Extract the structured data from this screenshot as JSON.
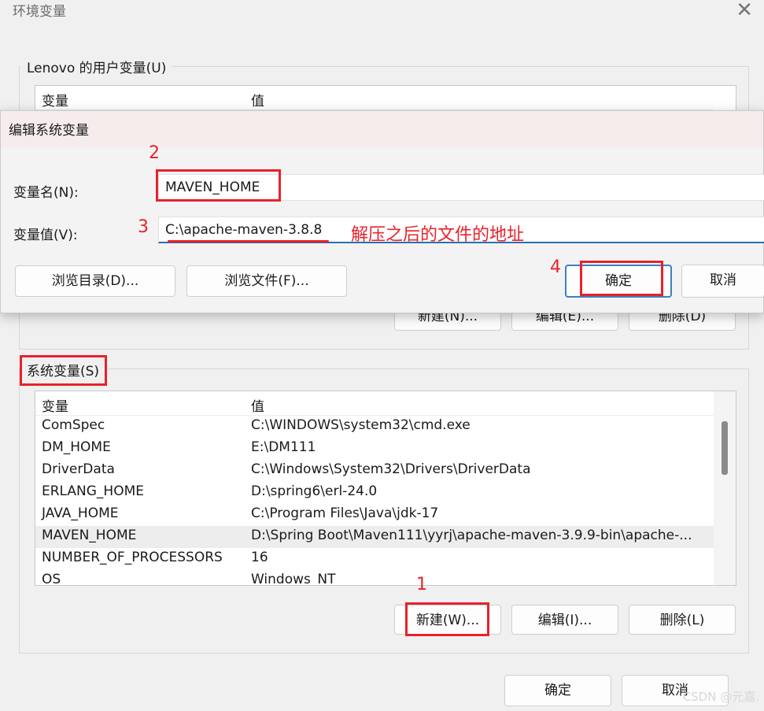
{
  "window": {
    "title": "环境变量",
    "close_glyph": "✕",
    "user_vars_label": "Lenovo 的用户变量(U)",
    "user_columns": [
      "变量",
      "值"
    ],
    "user_buttons": {
      "new": "新建(N)...",
      "edit": "编辑(E)...",
      "delete": "删除(D)"
    },
    "system_vars_label": "系统变量(S)",
    "system_columns": [
      "变量",
      "值"
    ],
    "system_rows": [
      {
        "name": "ComSpec",
        "value": "C:\\WINDOWS\\system32\\cmd.exe"
      },
      {
        "name": "DM_HOME",
        "value": "E:\\DM111"
      },
      {
        "name": "DriverData",
        "value": "C:\\Windows\\System32\\Drivers\\DriverData"
      },
      {
        "name": "ERLANG_HOME",
        "value": "D:\\spring6\\erl-24.0"
      },
      {
        "name": "JAVA_HOME",
        "value": "C:\\Program Files\\Java\\jdk-17"
      },
      {
        "name": "MAVEN_HOME",
        "value": "D:\\Spring Boot\\Maven111\\yyrj\\apache-maven-3.9.9-bin\\apache-..."
      },
      {
        "name": "NUMBER_OF_PROCESSORS",
        "value": "16"
      },
      {
        "name": "OS",
        "value": "Windows_NT"
      }
    ],
    "system_buttons": {
      "new": "新建(W)...",
      "edit": "编辑(I)...",
      "delete": "删除(L)"
    },
    "ok": "确定",
    "cancel": "取消"
  },
  "dialog": {
    "title": "编辑系统变量",
    "name_label": "变量名(N):",
    "name_value": "MAVEN_HOME",
    "value_label": "变量值(V):",
    "value_value": "C:\\apache-maven-3.8.8",
    "browse_dir": "浏览目录(D)...",
    "browse_file": "浏览文件(F)...",
    "ok": "确定",
    "cancel": "取消"
  },
  "annotations": {
    "step1": "1",
    "step2": "2",
    "step3": "3",
    "step4": "4",
    "note": "解压之后的文件的地址",
    "color": "#e8222b"
  },
  "watermark": "CSDN @元嘉."
}
